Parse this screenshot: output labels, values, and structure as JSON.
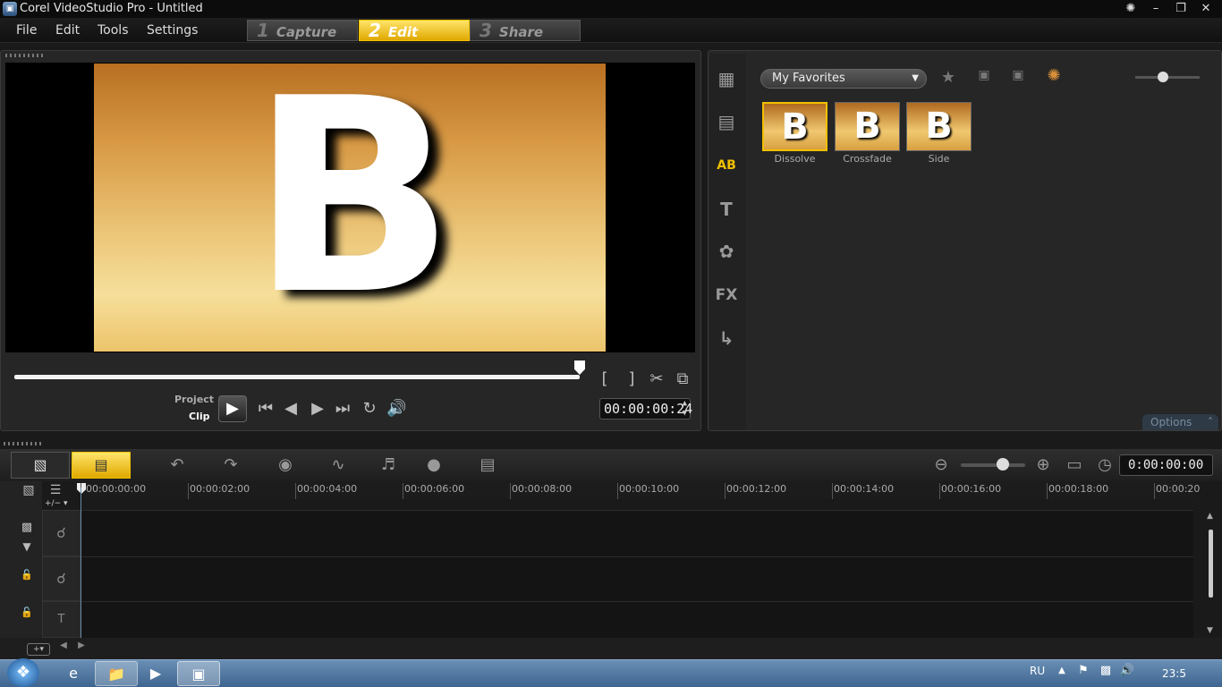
{
  "window": {
    "title": "Corel VideoStudio Pro - Untitled"
  },
  "menu": {
    "items": [
      "File",
      "Edit",
      "Tools",
      "Settings"
    ]
  },
  "steps": [
    {
      "num": "1",
      "label": "Capture"
    },
    {
      "num": "2",
      "label": "Edit"
    },
    {
      "num": "3",
      "label": "Share"
    }
  ],
  "preview": {
    "letter": "B",
    "mode_project": "Project",
    "mode_clip": "Clip",
    "timecode": "00:00:00:24"
  },
  "library": {
    "folder": "My Favorites",
    "items": [
      {
        "label": "Dissolve"
      },
      {
        "label": "Crossfade"
      },
      {
        "label": "Side"
      }
    ],
    "thumb_letter": "B",
    "options_label": "Options"
  },
  "timeline": {
    "timecode": "0:00:00:00",
    "ruler": [
      "00:00:00:00",
      "00:00:02:00",
      "00:00:04:00",
      "00:00:06:00",
      "00:00:08:00",
      "00:00:10:00",
      "00:00:12:00",
      "00:00:14:00",
      "00:00:16:00",
      "00:00:18:00",
      "00:00:20"
    ],
    "add_track_label": "+/− ▾"
  },
  "taskbar": {
    "lang": "RU",
    "clock": "23:5"
  },
  "colors": {
    "accent": "#f0c000",
    "background": "#1a1a1a"
  },
  "icons": {
    "side": [
      "media-icon",
      "instant-project-icon",
      "transition-icon",
      "title-icon",
      "graphic-icon",
      "filter-icon",
      "path-icon"
    ],
    "side_glyphs": [
      "▦",
      "▤",
      "AB",
      "T",
      "✿",
      "FX",
      "↳"
    ]
  }
}
